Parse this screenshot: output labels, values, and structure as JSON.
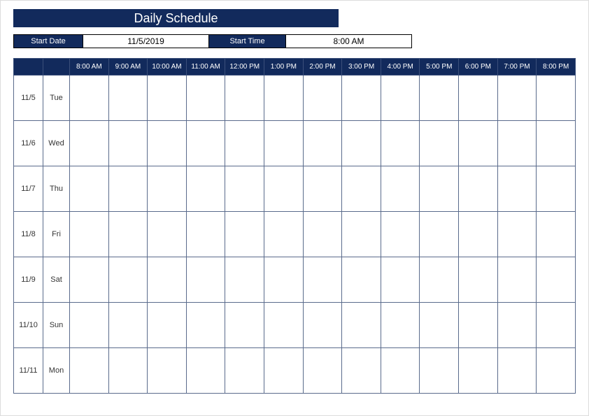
{
  "title": "Daily Schedule",
  "controls": {
    "start_date_label": "Start Date",
    "start_date_value": "11/5/2019",
    "start_time_label": "Start Time",
    "start_time_value": "8:00 AM"
  },
  "time_columns": [
    "8:00 AM",
    "9:00 AM",
    "10:00 AM",
    "11:00 AM",
    "12:00 PM",
    "1:00 PM",
    "2:00 PM",
    "3:00 PM",
    "4:00 PM",
    "5:00 PM",
    "6:00 PM",
    "7:00 PM",
    "8:00 PM"
  ],
  "rows": [
    {
      "date": "11/5",
      "day": "Tue"
    },
    {
      "date": "11/6",
      "day": "Wed"
    },
    {
      "date": "11/7",
      "day": "Thu"
    },
    {
      "date": "11/8",
      "day": "Fri"
    },
    {
      "date": "11/9",
      "day": "Sat"
    },
    {
      "date": "11/10",
      "day": "Sun"
    },
    {
      "date": "11/11",
      "day": "Mon"
    }
  ]
}
